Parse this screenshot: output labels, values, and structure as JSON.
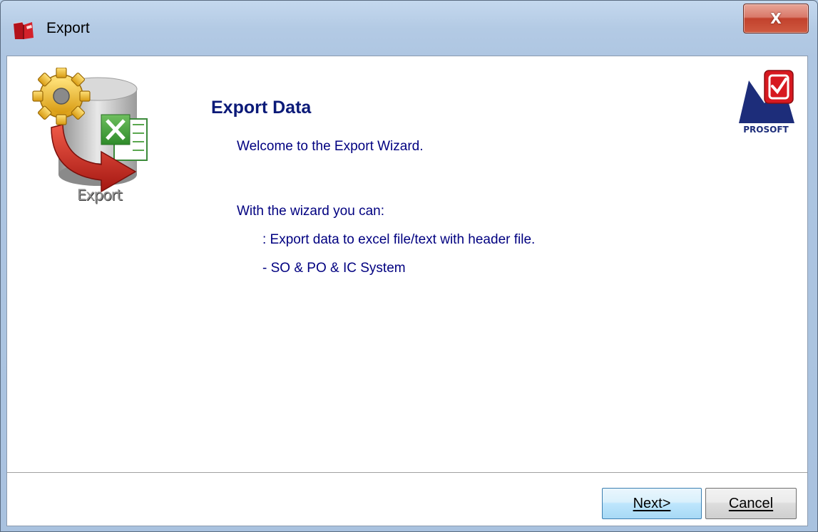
{
  "window": {
    "title": "Export",
    "close_label": "X"
  },
  "wizard": {
    "export_caption": "Export",
    "logo_text": "PROSOFT",
    "heading": "Export Data",
    "welcome": "Welcome to the Export Wizard.",
    "can_label": "With the wizard you can:",
    "features": [
      ": Export data to excel file/text with header file.",
      "- SO & PO & IC System"
    ]
  },
  "footer": {
    "next_label": "Next>",
    "cancel_label": "Cancel"
  },
  "colors": {
    "heading": "#0b1a78",
    "body_text": "#000080",
    "frame": "#b3cae4"
  },
  "icons": {
    "title": "export-book-icon",
    "graphic": "database-to-excel-export-icon",
    "logo": "prosoft-logo"
  }
}
